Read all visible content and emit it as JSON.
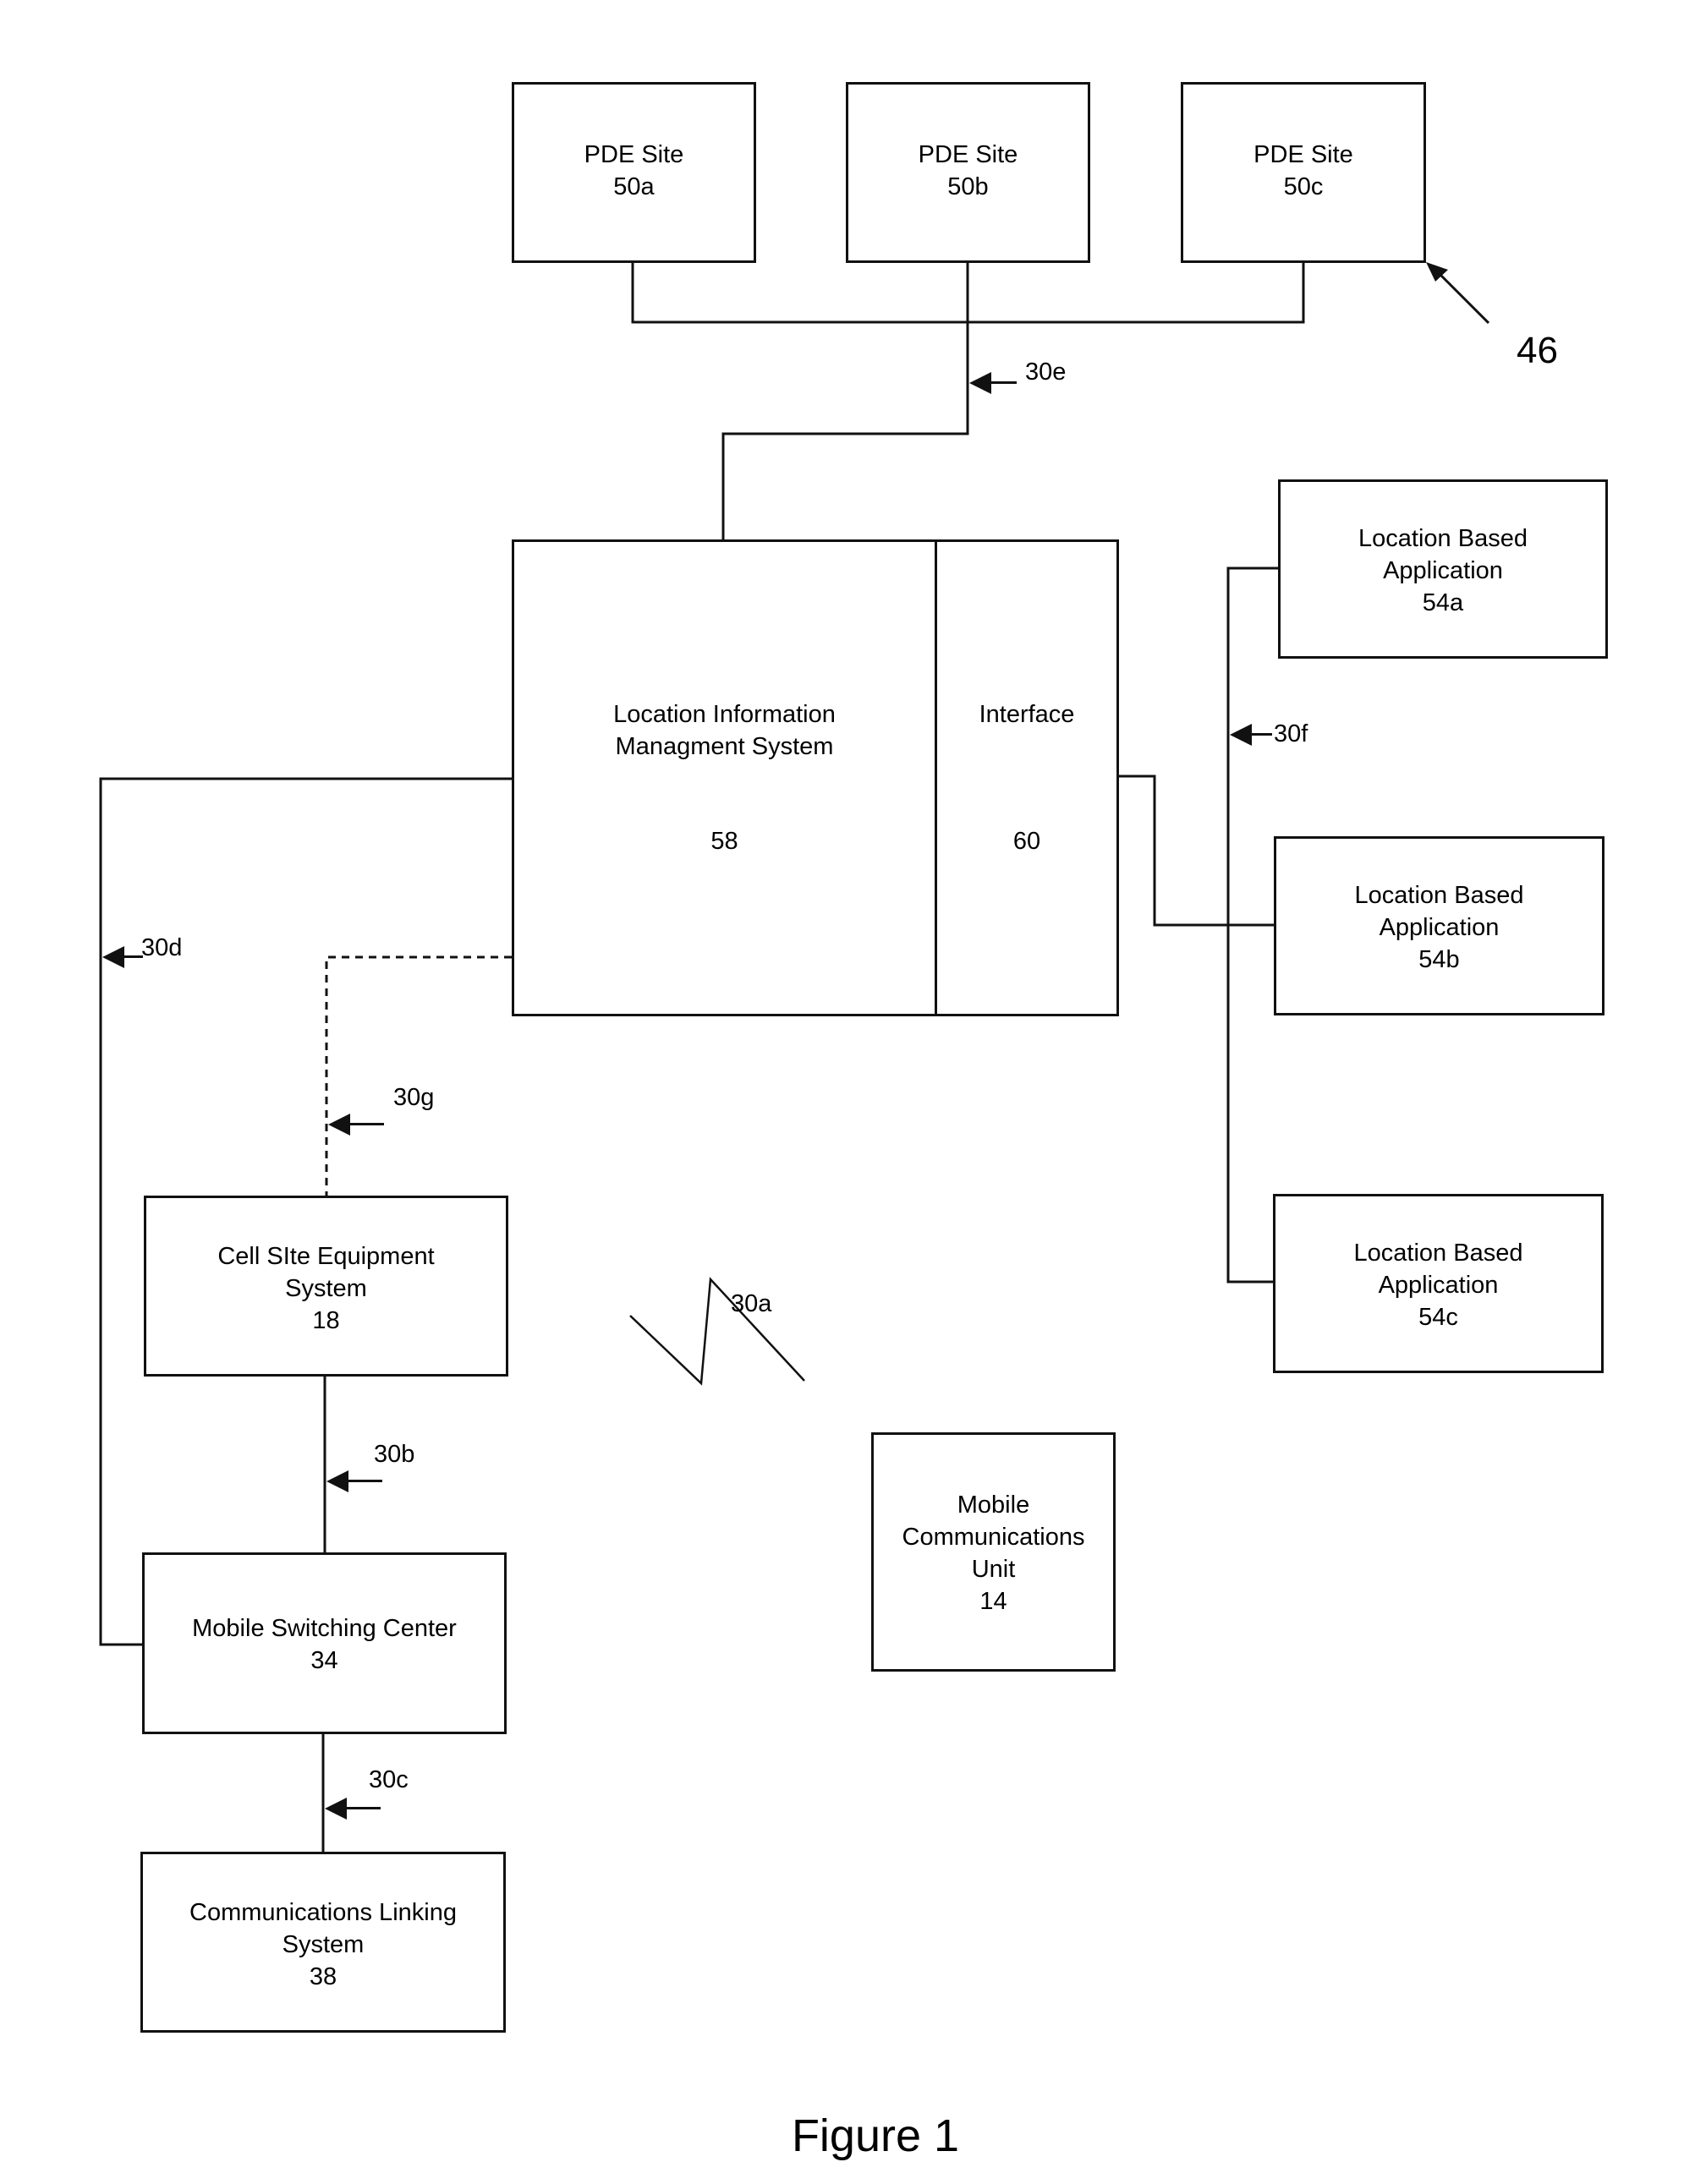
{
  "figure": {
    "caption": "Figure 1",
    "reference_46": "46"
  },
  "pde_sites": [
    {
      "name": "PDE Site",
      "id": "50a"
    },
    {
      "name": "PDE Site",
      "id": "50b"
    },
    {
      "name": "PDE Site",
      "id": "50c"
    }
  ],
  "lims": {
    "line1": "Location Information",
    "line2": "Managment System",
    "id": "58"
  },
  "interface": {
    "name": "Interface",
    "id": "60"
  },
  "location_apps": [
    {
      "line1": "Location Based",
      "line2": "Application",
      "id": "54a"
    },
    {
      "line1": "Location Based",
      "line2": "Application",
      "id": "54b"
    },
    {
      "line1": "Location Based",
      "line2": "Application",
      "id": "54c"
    }
  ],
  "cell_site": {
    "line1": "Cell SIte Equipment",
    "line2": "System",
    "id": "18"
  },
  "msc": {
    "line1": "Mobile Switching Center",
    "id": "34"
  },
  "cls": {
    "line1": "Communications Linking",
    "line2": "System",
    "id": "38"
  },
  "mcu": {
    "line1": "Mobile",
    "line2": "Communications",
    "line3": "Unit",
    "id": "14"
  },
  "links": {
    "a": "30a",
    "b": "30b",
    "c": "30c",
    "d": "30d",
    "e": "30e",
    "f": "30f",
    "g": "30g"
  }
}
